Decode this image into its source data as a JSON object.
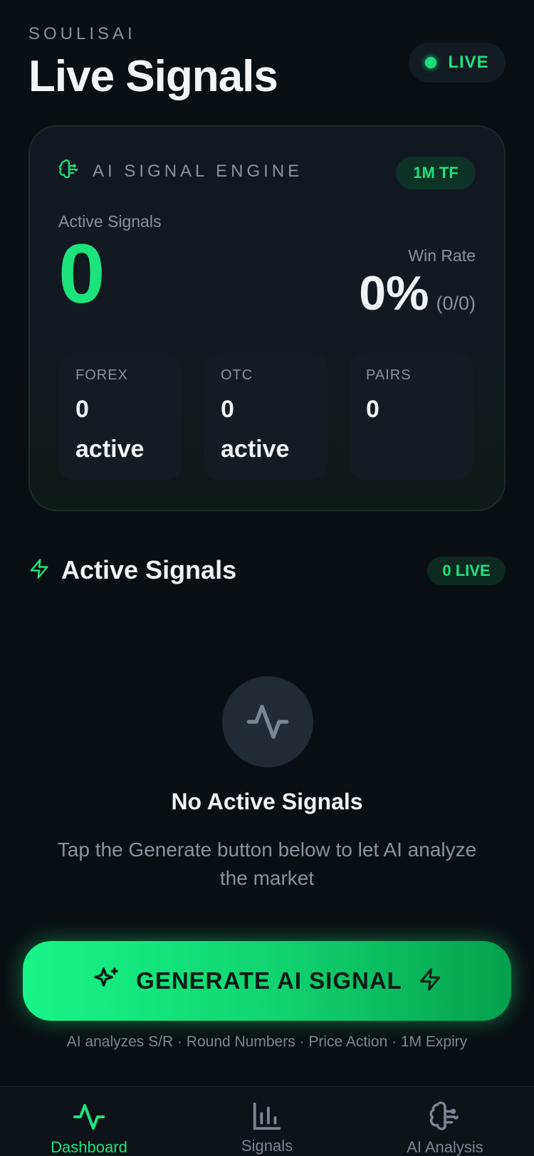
{
  "header": {
    "brand": "SOULISAI",
    "title": "Live Signals",
    "live_badge": "LIVE"
  },
  "engine": {
    "title": "AI SIGNAL ENGINE",
    "timeframe_badge": "1M TF",
    "active_signals_label": "Active Signals",
    "active_signals_value": "0",
    "win_rate_label": "Win Rate",
    "win_rate_value": "0%",
    "win_rate_count": "(0/0)",
    "stats": [
      {
        "label": "FOREX",
        "value": "0",
        "suffix": "active"
      },
      {
        "label": "OTC",
        "value": "0",
        "suffix": "active"
      },
      {
        "label": "PAIRS",
        "value": "0",
        "suffix": ""
      }
    ]
  },
  "section": {
    "title": "Active Signals",
    "count_badge": "0 LIVE"
  },
  "empty_state": {
    "title": "No Active Signals",
    "subtitle": "Tap the Generate button below to let AI analyze the market"
  },
  "generate": {
    "label": "GENERATE AI SIGNAL",
    "hint": "AI analyzes S/R · Round Numbers · Price Action · 1M Expiry"
  },
  "nav": {
    "items": [
      {
        "label": "Dashboard",
        "icon": "pulse-icon",
        "active": true
      },
      {
        "label": "Signals",
        "icon": "bar-chart-icon",
        "active": false
      },
      {
        "label": "AI Analysis",
        "icon": "brain-icon",
        "active": false
      }
    ]
  },
  "colors": {
    "accent": "#1de37d",
    "background": "#0a0f13",
    "muted": "#8a939c"
  }
}
